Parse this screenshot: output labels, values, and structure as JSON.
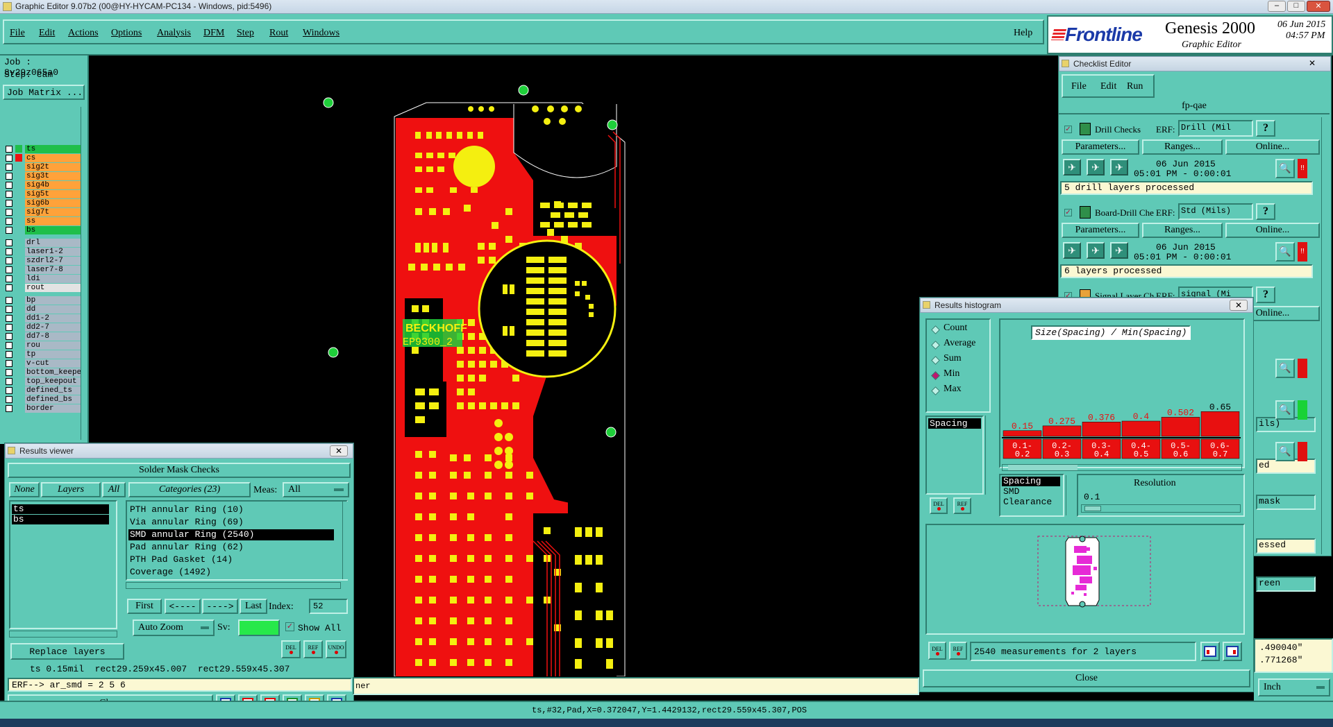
{
  "window": {
    "title": "Graphic Editor 9.07b2 (00@HY-HYCAM-PC134 - Windows, pid:5496)"
  },
  "menu": [
    "File",
    "Edit",
    "Actions",
    "Options",
    "Analysis",
    "DFM",
    "Step",
    "Rout",
    "Windows"
  ],
  "help": "Help",
  "brand": {
    "logo": "Frontline",
    "product": "Genesis 2000",
    "subtitle": "Graphic Editor",
    "date": "06 Jun 2015",
    "time": "04:57 PM"
  },
  "job": {
    "job": "Job : 8v29z065a0",
    "step": "Step: cam",
    "matrix_button": "Job Matrix ..."
  },
  "layers": [
    {
      "name": "ts",
      "color": "#1fbf4a",
      "swatch": "#1fbf4a"
    },
    {
      "name": "cs",
      "color": "#ffa23a",
      "swatch": "#e11"
    },
    {
      "name": "sig2t",
      "color": "#ffa23a",
      "swatch": ""
    },
    {
      "name": "sig3t",
      "color": "#ffa23a",
      "swatch": ""
    },
    {
      "name": "sig4b",
      "color": "#ffa23a",
      "swatch": ""
    },
    {
      "name": "sig5t",
      "color": "#ffa23a",
      "swatch": ""
    },
    {
      "name": "sig6b",
      "color": "#ffa23a",
      "swatch": ""
    },
    {
      "name": "sig7t",
      "color": "#ffa23a",
      "swatch": ""
    },
    {
      "name": "ss",
      "color": "#ffa23a",
      "swatch": ""
    },
    {
      "name": "bs",
      "color": "#1fbf4a",
      "swatch": ""
    },
    {
      "name": "drl",
      "color": "#a9b9c6",
      "swatch": ""
    },
    {
      "name": "laser1-2",
      "color": "#a9b9c6",
      "swatch": ""
    },
    {
      "name": "szdrl2-7",
      "color": "#a9b9c6",
      "swatch": ""
    },
    {
      "name": "laser7-8",
      "color": "#a9b9c6",
      "swatch": ""
    },
    {
      "name": "ldi",
      "color": "#a9b9c6",
      "swatch": ""
    },
    {
      "name": "rout",
      "color": "#e3e3e3",
      "swatch": ""
    },
    {
      "name": "bp",
      "color": "#a9b9c6",
      "swatch": ""
    },
    {
      "name": "dd",
      "color": "#a9b9c6",
      "swatch": ""
    },
    {
      "name": "dd1-2",
      "color": "#a9b9c6",
      "swatch": ""
    },
    {
      "name": "dd2-7",
      "color": "#a9b9c6",
      "swatch": ""
    },
    {
      "name": "dd7-8",
      "color": "#a9b9c6",
      "swatch": ""
    },
    {
      "name": "rou",
      "color": "#a9b9c6",
      "swatch": ""
    },
    {
      "name": "tp",
      "color": "#a9b9c6",
      "swatch": ""
    },
    {
      "name": "v-cut",
      "color": "#a9b9c6",
      "swatch": ""
    },
    {
      "name": "bottom_keepe",
      "color": "#a9b9c6",
      "swatch": ""
    },
    {
      "name": "top_keepout",
      "color": "#a9b9c6",
      "swatch": ""
    },
    {
      "name": "defined_ts",
      "color": "#a9b9c6",
      "swatch": ""
    },
    {
      "name": "defined_bs",
      "color": "#a9b9c6",
      "swatch": ""
    },
    {
      "name": "border",
      "color": "#a9b9c6",
      "swatch": ""
    }
  ],
  "results_viewer": {
    "title": "Results viewer",
    "header": "Solder Mask Checks",
    "none_btn": "None",
    "layers_btn": "Layers",
    "all_btn": "All",
    "categories_label": "Categories (23)",
    "meas_label": "Meas:",
    "meas_value": "All",
    "layer_list": [
      "ts",
      "bs"
    ],
    "categories": [
      "PTH annular Ring (10)",
      "Via annular Ring (69)",
      "SMD annular Ring (2540)",
      "Pad annular Ring (62)",
      "PTH Pad Gasket (14)",
      "Coverage (1492)"
    ],
    "selected_category": 2,
    "first": "First",
    "prev": "<----",
    "next": "---->",
    "last": "Last",
    "index_label": "Index:",
    "index_value": "52",
    "auto_zoom": "Auto Zoom",
    "sv_label": "Sv:",
    "show_all": "Show All",
    "replace_layers": "Replace layers",
    "del": "DEL",
    "ref": "REF",
    "undo": "UNDO",
    "status": "ts 0.15mil  rect29.259x45.007  rect29.559x45.307",
    "erf": "ERF--> ar_smd = 2 5 6",
    "close": "Close"
  },
  "histogram": {
    "title": "Results histogram",
    "modes": [
      "Count",
      "Average",
      "Sum",
      "Min",
      "Max"
    ],
    "selected_mode": "Min",
    "chart_title": "Size(Spacing) / Min(Spacing)",
    "list_item": "Spacing",
    "chart_data": {
      "type": "bar",
      "title": "Size(Spacing) / Min(Spacing)",
      "categories": [
        "0.1-0.2",
        "0.2-0.3",
        "0.3-0.4",
        "0.4-0.5",
        "0.5-0.6",
        "0.6-0.7"
      ],
      "values": [
        0.15,
        0.275,
        0.376,
        0.4,
        0.502,
        0.65
      ],
      "value_labels": [
        "0.15",
        "0.275",
        "0.376",
        "0.4",
        "0.502",
        "0.65"
      ],
      "category_top": [
        "0.1-",
        "0.2-",
        "0.3-",
        "0.4-",
        "0.5-",
        "0.6-"
      ],
      "category_bottom": [
        "0.2",
        "0.3",
        "0.4",
        "0.5",
        "0.6",
        "0.7"
      ],
      "ylim": [
        0,
        0.7
      ],
      "bar_color": "#e81010",
      "label_color": "#e81010",
      "last_label_color": "#000000"
    },
    "types": [
      "Spacing",
      "SMD",
      "Clearance"
    ],
    "resolution_label": "Resolution",
    "resolution_value": "0.1",
    "del": "DEL",
    "ref": "REF",
    "measurements": "2540 measurements for 2 layers",
    "close": "Close"
  },
  "checklist": {
    "title": "Checklist Editor",
    "menu": [
      "File",
      "Edit",
      "Run"
    ],
    "name": "fp-qae",
    "checks": [
      {
        "name": "Drill Checks",
        "erf": "ERF:",
        "value": "Drill (Mil",
        "processed": "5 drill layers processed"
      },
      {
        "name": "Board-Drill Che",
        "erf": "ERF:",
        "value": "Std (Mils)",
        "processed": "6 layers processed"
      },
      {
        "name": "Signal Layer Ch",
        "erf": "ERF:",
        "value": "signal (Mi",
        "processed": ""
      }
    ],
    "parameters": "Parameters...",
    "ranges": "Ranges...",
    "online": "Online...",
    "run_date": "06 Jun 2015",
    "run_time": "05:01 PM - 0:00:01",
    "partial": [
      "ils)",
      "ed",
      "mask",
      "essed",
      "reen"
    ]
  },
  "coords": {
    "x": ".490040\"",
    "y": ".771268\""
  },
  "units": "Inch",
  "bottom_msg": "ner",
  "status_bar": "ts,#32,Pad,X=0.372047,Y=1.4429132,rect29.559x45.307,POS",
  "pcb": {
    "label1": "BECKHOFF",
    "label2": "EP9300_2"
  }
}
